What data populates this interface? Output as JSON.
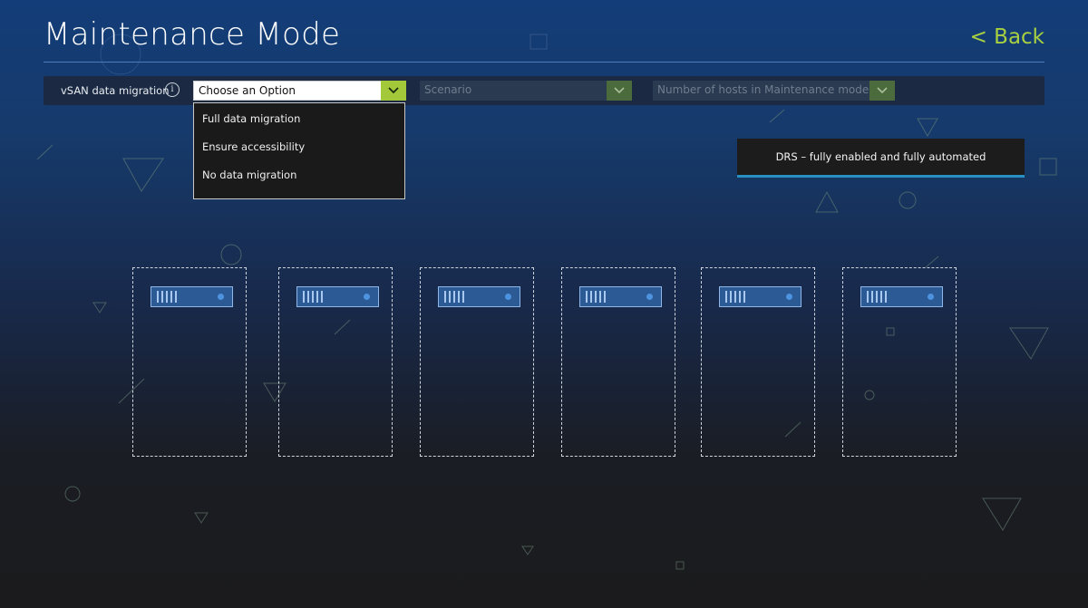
{
  "header": {
    "title": "Maintenance Mode",
    "back_label": "< Back"
  },
  "filters": {
    "migration_label": "vSAN data migration",
    "migration_value": "Choose an Option",
    "scenario_placeholder": "Scenario",
    "hosts_placeholder": "Number of hosts in Maintenance mode"
  },
  "dropdown": {
    "options": [
      "Full data migration",
      "Ensure accessibility",
      "No data migration"
    ]
  },
  "drs_banner": "DRS – fully enabled and fully automated",
  "hosts": {
    "count": 6
  },
  "colors": {
    "accent_green": "#a8d041",
    "banner_underline": "#2a8fc3",
    "server_fill": "#2c5a94"
  },
  "icons": {
    "info": "info-icon",
    "dropdown": "chevron-down-icon",
    "server": "server-icon"
  }
}
